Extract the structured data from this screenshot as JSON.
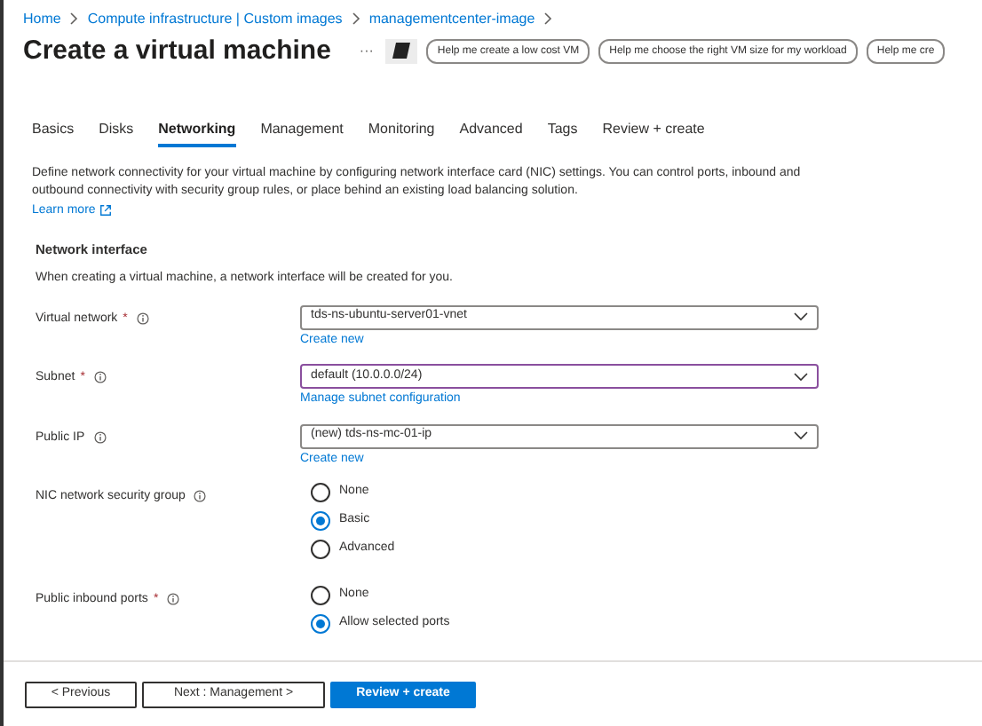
{
  "breadcrumbs": [
    "Home",
    "Compute infrastructure | Custom images",
    "managementcenter-image"
  ],
  "title": "Create a virtual machine",
  "more_button": "···",
  "chips": [
    "Help me create a low cost VM",
    "Help me choose the right VM size for my workload",
    "Help me cre"
  ],
  "tabs": [
    {
      "label": "Basics",
      "selected": false
    },
    {
      "label": "Disks",
      "selected": false
    },
    {
      "label": "Networking",
      "selected": true
    },
    {
      "label": "Management",
      "selected": false
    },
    {
      "label": "Monitoring",
      "selected": false
    },
    {
      "label": "Advanced",
      "selected": false
    },
    {
      "label": "Tags",
      "selected": false
    },
    {
      "label": "Review + create",
      "selected": false
    }
  ],
  "description": "Define network connectivity for your virtual machine by configuring network interface card (NIC) settings. You can control ports, inbound and outbound connectivity with security group rules, or place behind an existing load balancing solution.",
  "learn_more": "Learn more",
  "section": {
    "heading": "Network interface",
    "description": "When creating a virtual machine, a network interface will be created for you."
  },
  "fields": [
    {
      "kind": "dropdown",
      "label": "Virtual network",
      "required_mark": "*",
      "value": "tds-ns-ubuntu-server01-vnet",
      "focused": false,
      "link": "Create new"
    },
    {
      "kind": "dropdown",
      "label": "Subnet",
      "required_mark": "*",
      "value": "default (10.0.0.0/24)",
      "focused": true,
      "link": "Manage subnet configuration"
    },
    {
      "kind": "dropdown",
      "label": "Public IP",
      "value": "(new) tds-ns-mc-01-ip",
      "focused": false,
      "link": "Create new"
    },
    {
      "kind": "radio",
      "label": "NIC network security group",
      "options": [
        {
          "label": "None",
          "selected": false
        },
        {
          "label": "Basic",
          "selected": true
        },
        {
          "label": "Advanced",
          "selected": false
        }
      ]
    },
    {
      "kind": "radio",
      "label": "Public inbound ports",
      "required_mark": "*",
      "options": [
        {
          "label": "None",
          "selected": false
        },
        {
          "label": "Allow selected ports",
          "selected": true
        }
      ]
    }
  ],
  "buttons": [
    {
      "label": "< Previous",
      "kind": "secondary"
    },
    {
      "label": "Next : Management >",
      "kind": "secondary"
    },
    {
      "label": "Review + create",
      "kind": "primary"
    }
  ]
}
